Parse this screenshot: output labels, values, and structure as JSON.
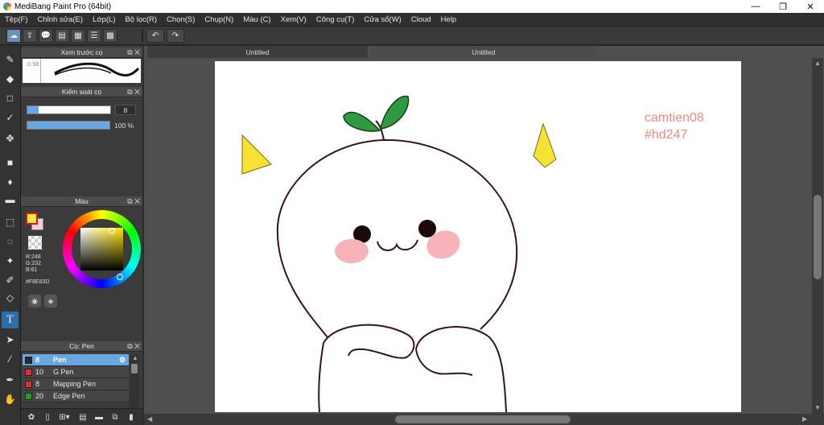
{
  "window": {
    "title": "MediBang Paint Pro (64bit)"
  },
  "menu": [
    "Tệp(F)",
    "Chỉnh sửa(E)",
    "Lớp(L)",
    "Bộ lọc(R)",
    "Chọn(S)",
    "Chụp(N)",
    "Màu (C)",
    "Xem(V)",
    "Công cụ(T)",
    "Cửa sổ(W)",
    "Cloud",
    "Help"
  ],
  "tabs": [
    "Untitled",
    "Untitled"
  ],
  "panels": {
    "brush_preview": {
      "title": "Xem trước cọ",
      "size_label": "0.58"
    },
    "brush_control": {
      "title": "Kiểm soát cọ",
      "size_value": "8",
      "size_fraction": 0.14,
      "opacity_value": "100 %",
      "opacity_fraction": 1.0
    },
    "color": {
      "title": "Màu",
      "r": "R:248",
      "g": "G:232",
      "b": "B:61",
      "hex": "#F8E83D",
      "fg": "#F8E83D"
    },
    "brush_list": {
      "title": "Cọ: Pen",
      "items": [
        {
          "size": "8",
          "name": "Pen",
          "color": "#2a2a2a",
          "selected": true
        },
        {
          "size": "10",
          "name": "G Pen",
          "color": "#e03030",
          "selected": false
        },
        {
          "size": "8",
          "name": "Mapping Pen",
          "color": "#e03030",
          "selected": false
        },
        {
          "size": "20",
          "name": "Edge Pen",
          "color": "#20a020",
          "selected": false
        }
      ]
    }
  },
  "canvas": {
    "watermark_line1": "camtien08",
    "watermark_line2": "#hd247",
    "watermark_color": "#f08a7a",
    "leaf_color": "#2e9a40",
    "star_color": "#f5e233",
    "blush_color": "#f7b2ba",
    "line_color": "#3a1414"
  }
}
